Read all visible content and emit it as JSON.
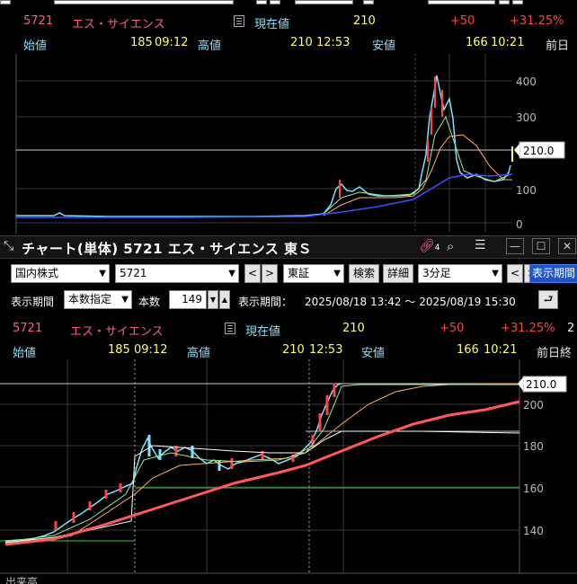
{
  "top_panel": {
    "code": "5721",
    "name": "エス・サイエンス",
    "current_label": "現在値",
    "current_value": "210",
    "change": "+50",
    "change_pct": "+31.25%",
    "open_label": "始値",
    "open_value": "185",
    "open_time": "09:12",
    "high_label": "高値",
    "high_value": "210",
    "high_time": "12:53",
    "low_label": "安値",
    "low_value": "166",
    "low_time": "10:21",
    "prev_label": "前日",
    "price_tag": "210.0",
    "axis_ticks": [
      "400",
      "300",
      "200",
      "100",
      "0"
    ]
  },
  "window": {
    "title": "チャート(単体) 5721 エス・サイエンス 東Ｓ",
    "link_badge": "4",
    "minimize": "—",
    "maximize": "☐",
    "close": "✕"
  },
  "toolbar": {
    "market_select": "国内株式",
    "code_input": "5721",
    "prev_arrow": "<",
    "next_arrow": ">",
    "exchange_select": "東証",
    "search_button": "検索",
    "detail_button": "詳細",
    "timeframe_select": "3分足",
    "display_period_button": "表示期間",
    "period_label": "表示期間",
    "period_mode_select": "本数指定",
    "count_label": "本数",
    "count_value": "149",
    "range_label": "表示期間：",
    "range_value": "2025/08/18 13:42 ～ 2025/08/19 15:30",
    "return_icon": "⮐"
  },
  "bottom_panel": {
    "code": "5721",
    "name": "エス・サイエンス",
    "current_label": "現在値",
    "current_value": "210",
    "change": "+50",
    "change_pct": "+31.25%",
    "trailing": "2",
    "open_label": "始値",
    "open_value": "185",
    "open_time": "09:12",
    "high_label": "高値",
    "high_value": "210",
    "high_time": "12:53",
    "low_label": "安値",
    "low_value": "166",
    "low_time": "10:21",
    "prev_label": "前日終",
    "price_tag": "210.0",
    "axis_ticks": [
      "200",
      "180",
      "160",
      "140"
    ],
    "footer_text": "出来高"
  },
  "colors": {
    "up": "#ff4444",
    "down": "#7fe0ff",
    "ma_short": "#90ee90",
    "ma_mid": "#ffb060",
    "ma_long": "#3c50ff",
    "ma_bold": "#ff5a5a",
    "highlight": "#ffff66"
  }
}
